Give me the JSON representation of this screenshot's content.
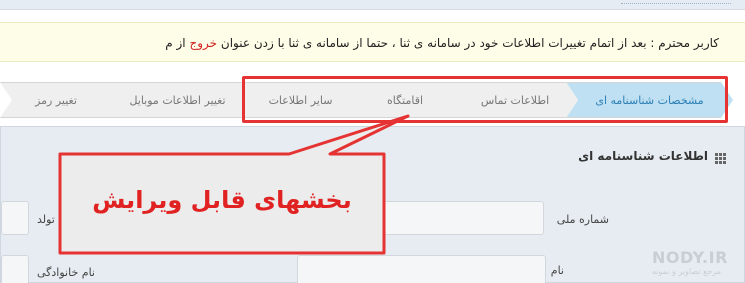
{
  "notice": {
    "prefix": "کاربر محترم : بعد از اتمام تغییرات اطلاعات خود در سامانه ی ثنا ، حتما از سامانه ی ثنا با زدن عنوان",
    "exit_link": "خروج",
    "suffix": "از م"
  },
  "tabs": [
    {
      "label": "مشخصات شناسنامه ای",
      "active": true
    },
    {
      "label": "اطلاعات تماس",
      "active": false
    },
    {
      "label": "اقامتگاه",
      "active": false
    },
    {
      "label": "سایر اطلاعات",
      "active": false
    },
    {
      "label": "تغییر اطلاعات موبایل",
      "active": false
    },
    {
      "label": "تغییر رمز",
      "active": false
    }
  ],
  "panel": {
    "title": "اطلاعات شناسنامه ای",
    "title_icon": "grid-icon",
    "fields": {
      "national_id": "شماره ملی",
      "birth": "تولد",
      "first_name": "نام",
      "last_name": "نام خانوادگی"
    }
  },
  "callout": {
    "text": "بخشهای قابل ویرایش"
  },
  "watermark": {
    "main": "NODY.IR",
    "sub": "مرجع تصاویر و نمونه"
  },
  "colors": {
    "highlight": "#e53333",
    "active_tab": "#bfe0f2",
    "exit_link": "#d32020"
  }
}
